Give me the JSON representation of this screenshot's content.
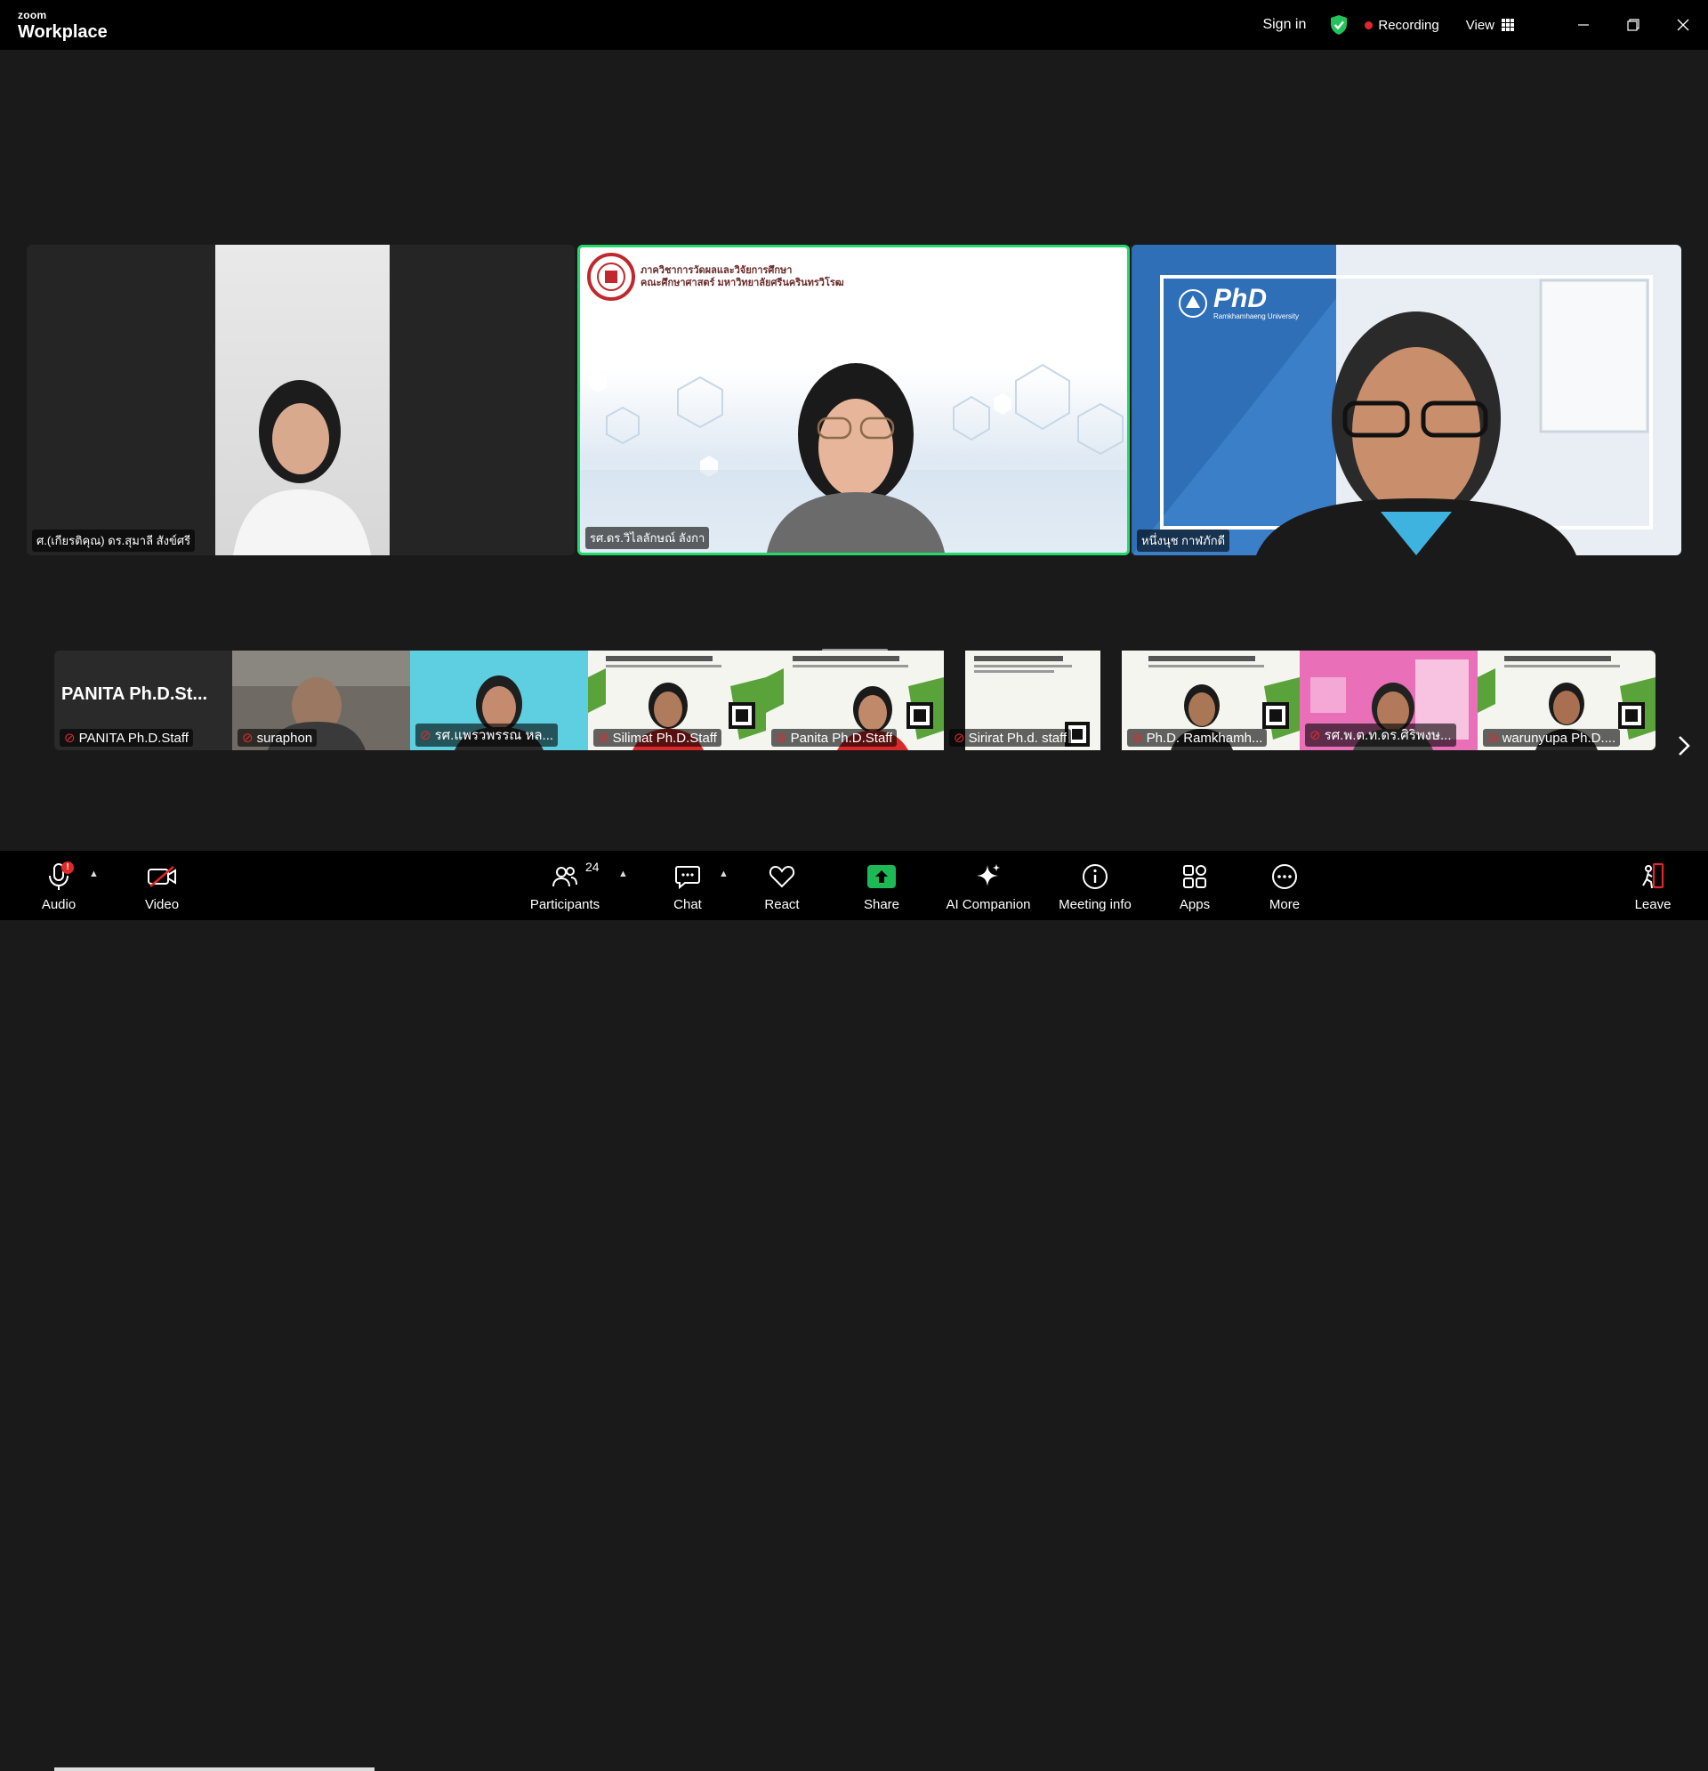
{
  "titlebar": {
    "brand_small": "zoom",
    "brand_large": "Workplace",
    "sign_in": "Sign in",
    "recording": "Recording",
    "view": "View"
  },
  "main_tiles": [
    {
      "name": "ศ.(เกียรติคุณ) ดร.สุมาลี สังข์ศรี"
    },
    {
      "name": "รศ.ดร.วิไลลักษณ์ ลังกา",
      "header_line1": "ภาควิชาการวัดผลและวิจัยการศึกษา",
      "header_line2": "คณะศึกษาศาสตร์ มหาวิทยาลัยศรีนครินทรวิโรฒ"
    },
    {
      "name": "หนึ่งนุช กาฬภักดี",
      "logo": "PhD",
      "logo_sub": "Ramkhamhaeng University"
    }
  ],
  "thumbnails": [
    {
      "name": "PANITA Ph.D.Staff",
      "title": "PANITA Ph.D.St...",
      "bg": "#2a2a2a"
    },
    {
      "name": "suraphon",
      "bg": "#6f6a63"
    },
    {
      "name": "รศ.แพรวพรรณ หล...",
      "bg": "#5ecfe0"
    },
    {
      "name": "Silimat Ph.D.Staff",
      "bg": "#f3f5ee"
    },
    {
      "name": "Panita Ph.D.Staff",
      "bg": "#f3f5ee"
    },
    {
      "name": "Sirirat Ph.d. staff",
      "bg": "#f3f5ee"
    },
    {
      "name": "Ph.D. Ramkhamh...",
      "bg": "#f3f5ee"
    },
    {
      "name": "รศ.พ.ต.ท.ดร.ศิริพงษ...",
      "bg": "#e86fb8"
    },
    {
      "name": "warunyupa Ph.D....",
      "bg": "#f3f5ee"
    }
  ],
  "toolbar": {
    "audio": "Audio",
    "audio_badge": "!",
    "video": "Video",
    "participants": "Participants",
    "participants_count": "24",
    "chat": "Chat",
    "react": "React",
    "share": "Share",
    "ai_companion": "AI Companion",
    "meeting_info": "Meeting info",
    "apps": "Apps",
    "more": "More",
    "leave": "Leave"
  },
  "colors": {
    "active_speaker_border": "#23d96b",
    "recording_dot": "#e02828",
    "share_green": "#1db954",
    "leave_red": "#e02828"
  }
}
